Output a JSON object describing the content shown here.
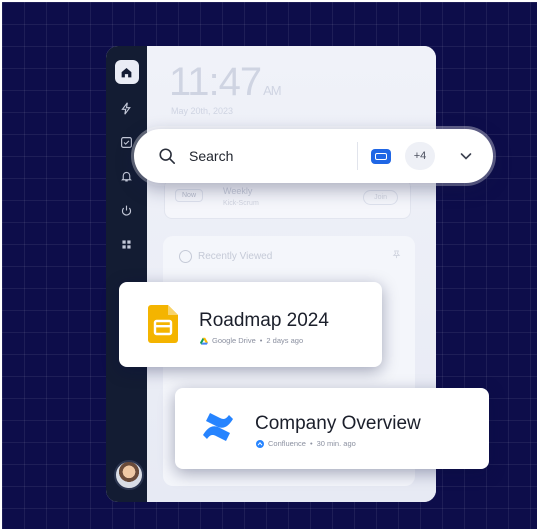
{
  "clock": {
    "time": "11:47",
    "ampm": "AM",
    "date": "May 20th, 2023"
  },
  "sidebar": {
    "items": [
      {
        "icon": "home-icon"
      },
      {
        "icon": "bolt-icon"
      },
      {
        "icon": "check-square-icon"
      },
      {
        "icon": "bell-icon"
      },
      {
        "icon": "power-icon"
      },
      {
        "icon": "grid-icon"
      }
    ]
  },
  "event": {
    "now": "Now",
    "title": "Weekly",
    "subtitle": "Kick-Scrum",
    "action": "Join"
  },
  "recent": {
    "title": "Recently Viewed"
  },
  "search": {
    "label": "Search",
    "extra_count": "+4"
  },
  "cards": [
    {
      "title": "Roadmap 2024",
      "source": "Google Drive",
      "time": "2 days ago"
    },
    {
      "title": "Company Overview",
      "source": "Confluence",
      "time": "30 min. ago"
    }
  ],
  "colors": {
    "background": "#0d0d4a",
    "sidebar": "#131c33",
    "accent": "#1f66e5",
    "slides_yellow": "#f4b400",
    "confluence_blue": "#2684ff"
  }
}
